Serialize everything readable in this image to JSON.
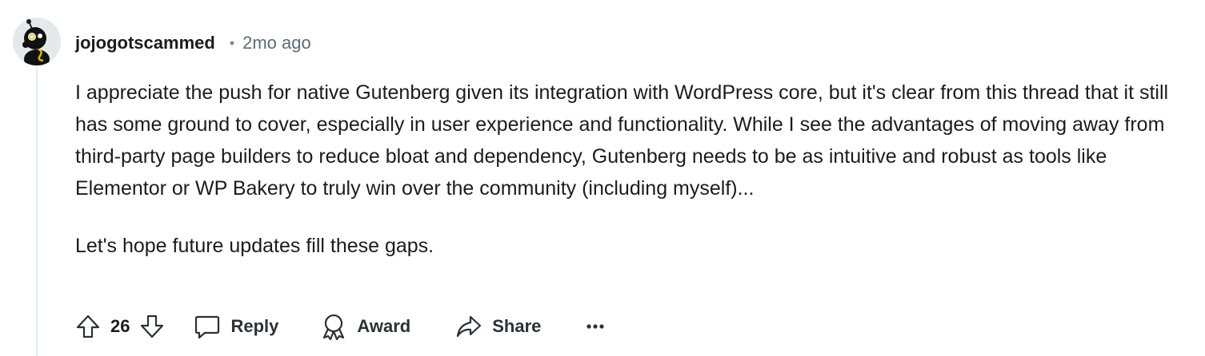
{
  "comment": {
    "author": "jojogotscammed",
    "separator": "•",
    "time_ago": "2mo ago",
    "avatar": "snoo-avatar",
    "paragraphs": [
      "I appreciate the push for native Gutenberg given its integration with WordPress core, but it's clear from this thread that it still has some ground to cover, especially in user experience and functionality. While I see the advantages of moving away from third-party page builders to reduce bloat and dependency, Gutenberg needs to be as intuitive and robust as tools like Elementor or WP Bakery to truly win over the community (including myself)...",
      "Let's hope future updates fill these gaps."
    ]
  },
  "actions": {
    "upvote_icon": "upvote-arrow-icon",
    "vote_count": "26",
    "downvote_icon": "downvote-arrow-icon",
    "reply_icon": "speech-bubble-icon",
    "reply_label": "Reply",
    "award_icon": "award-ribbon-icon",
    "award_label": "Award",
    "share_icon": "share-arrow-icon",
    "share_label": "Share",
    "more_icon": "ellipsis-icon"
  },
  "colors": {
    "text": "#1c1c1c",
    "meta": "#5c6c74",
    "icon": "#2a3236",
    "thread_line": "#e5ebee"
  }
}
